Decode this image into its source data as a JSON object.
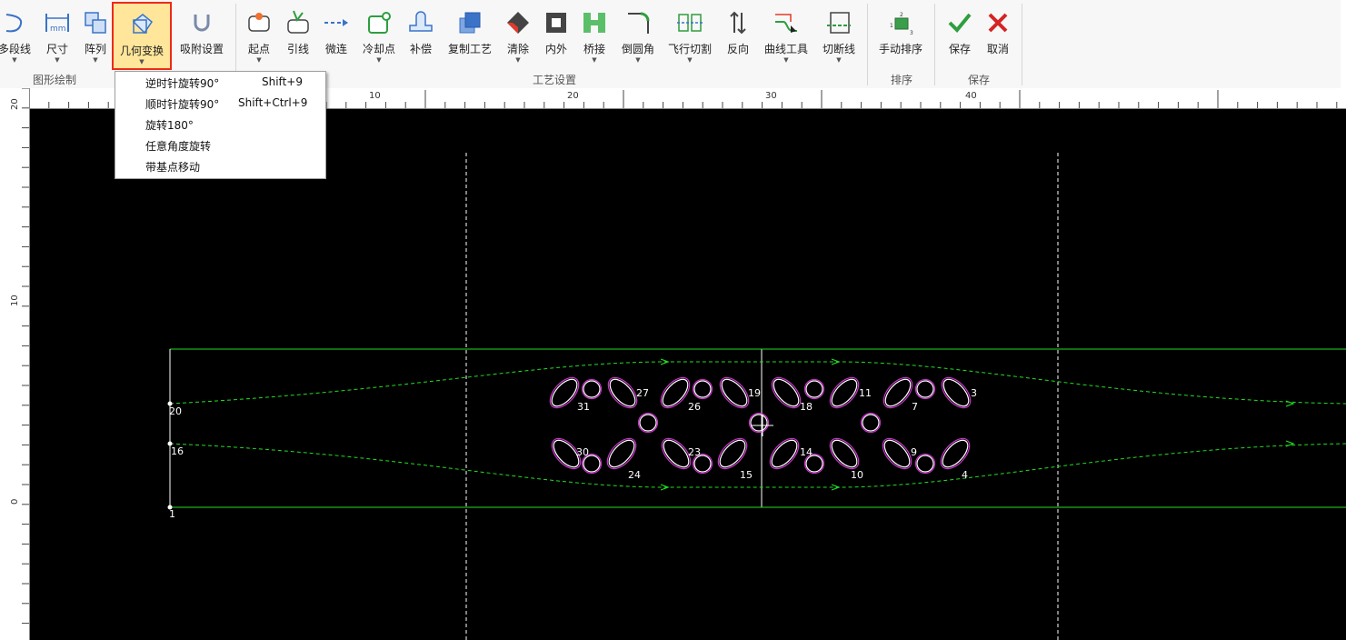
{
  "ribbon": {
    "buttons": [
      {
        "label": "多段线"
      },
      {
        "label": "尺寸"
      },
      {
        "label": "阵列"
      },
      {
        "label": "几何变换"
      },
      {
        "label": "吸附设置"
      },
      {
        "label": "起点"
      },
      {
        "label": "引线"
      },
      {
        "label": "微连"
      },
      {
        "label": "冷却点"
      },
      {
        "label": "补偿"
      },
      {
        "label": "复制工艺"
      },
      {
        "label": "清除"
      },
      {
        "label": "内外"
      },
      {
        "label": "桥接"
      },
      {
        "label": "倒圆角"
      },
      {
        "label": "飞行切割"
      },
      {
        "label": "反向"
      },
      {
        "label": "曲线工具"
      },
      {
        "label": "切断线"
      },
      {
        "label": "手动排序"
      },
      {
        "label": "保存"
      },
      {
        "label": "取消"
      }
    ],
    "groups": [
      "图形绘制",
      "工艺设置",
      "排序",
      "保存"
    ]
  },
  "dropdown": {
    "items": [
      {
        "label": "逆时针旋转90°",
        "shortcut": "Shift+9"
      },
      {
        "label": "顺时针旋转90°",
        "shortcut": "Shift+Ctrl+9"
      },
      {
        "label": "旋转180°",
        "shortcut": ""
      },
      {
        "label": "任意角度旋转",
        "shortcut": ""
      },
      {
        "label": "带基点移动",
        "shortcut": ""
      }
    ]
  },
  "rulers": {
    "h_labels": [
      "10",
      "20",
      "30",
      "40"
    ],
    "v_labels": [
      "20",
      "10",
      "0"
    ]
  },
  "canvas": {
    "part_numbers": [
      "20",
      "16",
      "1",
      "31",
      "27",
      "26",
      "19",
      "18",
      "11",
      "7",
      "3",
      "30",
      "24",
      "23",
      "15",
      "14",
      "10",
      "9",
      "4"
    ]
  },
  "colors": {
    "ribbon_bg": "#f7f7f7",
    "selected_bg": "#ffe69a",
    "selected_border": "#ee2a1a",
    "canvas_bg": "#000000",
    "path_green": "#22dd22",
    "hole_magenta": "#cc33cc",
    "save_green": "#2e9e3e",
    "cancel_red": "#d42424"
  }
}
